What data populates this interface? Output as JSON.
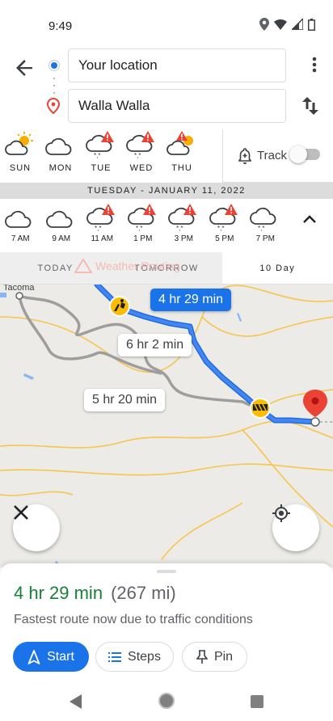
{
  "status_bar": {
    "time": "9:49"
  },
  "directions": {
    "from_value": "Your location",
    "to_value": "Walla Walla"
  },
  "weather": {
    "days": [
      {
        "label": "SUN",
        "icon": "partly-sunny-icon",
        "alert": false
      },
      {
        "label": "MON",
        "icon": "cloudy-icon",
        "alert": false
      },
      {
        "label": "TUE",
        "icon": "snow-cloud-icon",
        "alert": true
      },
      {
        "label": "WED",
        "icon": "snow-cloud-icon",
        "alert": true
      },
      {
        "label": "THU",
        "icon": "partly-sunny-icon",
        "alert": true
      }
    ],
    "track_label": "Track",
    "track_enabled": false,
    "date_label": "TUESDAY - JANUARY 11, 2022",
    "hours": [
      {
        "label": "7 AM",
        "icon": "cloudy-icon",
        "alert": false
      },
      {
        "label": "9 AM",
        "icon": "cloudy-icon",
        "alert": false
      },
      {
        "label": "11 AM",
        "icon": "snow-cloud-icon",
        "alert": true
      },
      {
        "label": "1 PM",
        "icon": "snow-cloud-icon",
        "alert": true
      },
      {
        "label": "3 PM",
        "icon": "snow-cloud-icon",
        "alert": true
      },
      {
        "label": "5 PM",
        "icon": "snow-cloud-icon",
        "alert": true
      },
      {
        "label": "7 PM",
        "icon": "snow-cloud-icon",
        "alert": false
      }
    ],
    "tabs": [
      "TODAY",
      "TOMORROW",
      "10 Day"
    ],
    "active_tab": 2,
    "watermark": "Weather Routing"
  },
  "map": {
    "town_label": "Tacoma",
    "route_primary": "4 hr 29 min",
    "route_alt1": "6 hr 2 min",
    "route_alt2": "5 hr 20 min",
    "route_color": "#4285f4",
    "alt_route_color": "#9e9e9e"
  },
  "sheet": {
    "duration": "4 hr 29 min",
    "distance": "(267 mi)",
    "note": "Fastest route now due to traffic conditions",
    "start_label": "Start",
    "steps_label": "Steps",
    "pin_label": "Pin"
  },
  "colors": {
    "accent": "#1a73e8",
    "eta_green": "#188038",
    "alert": "#ea4335"
  }
}
